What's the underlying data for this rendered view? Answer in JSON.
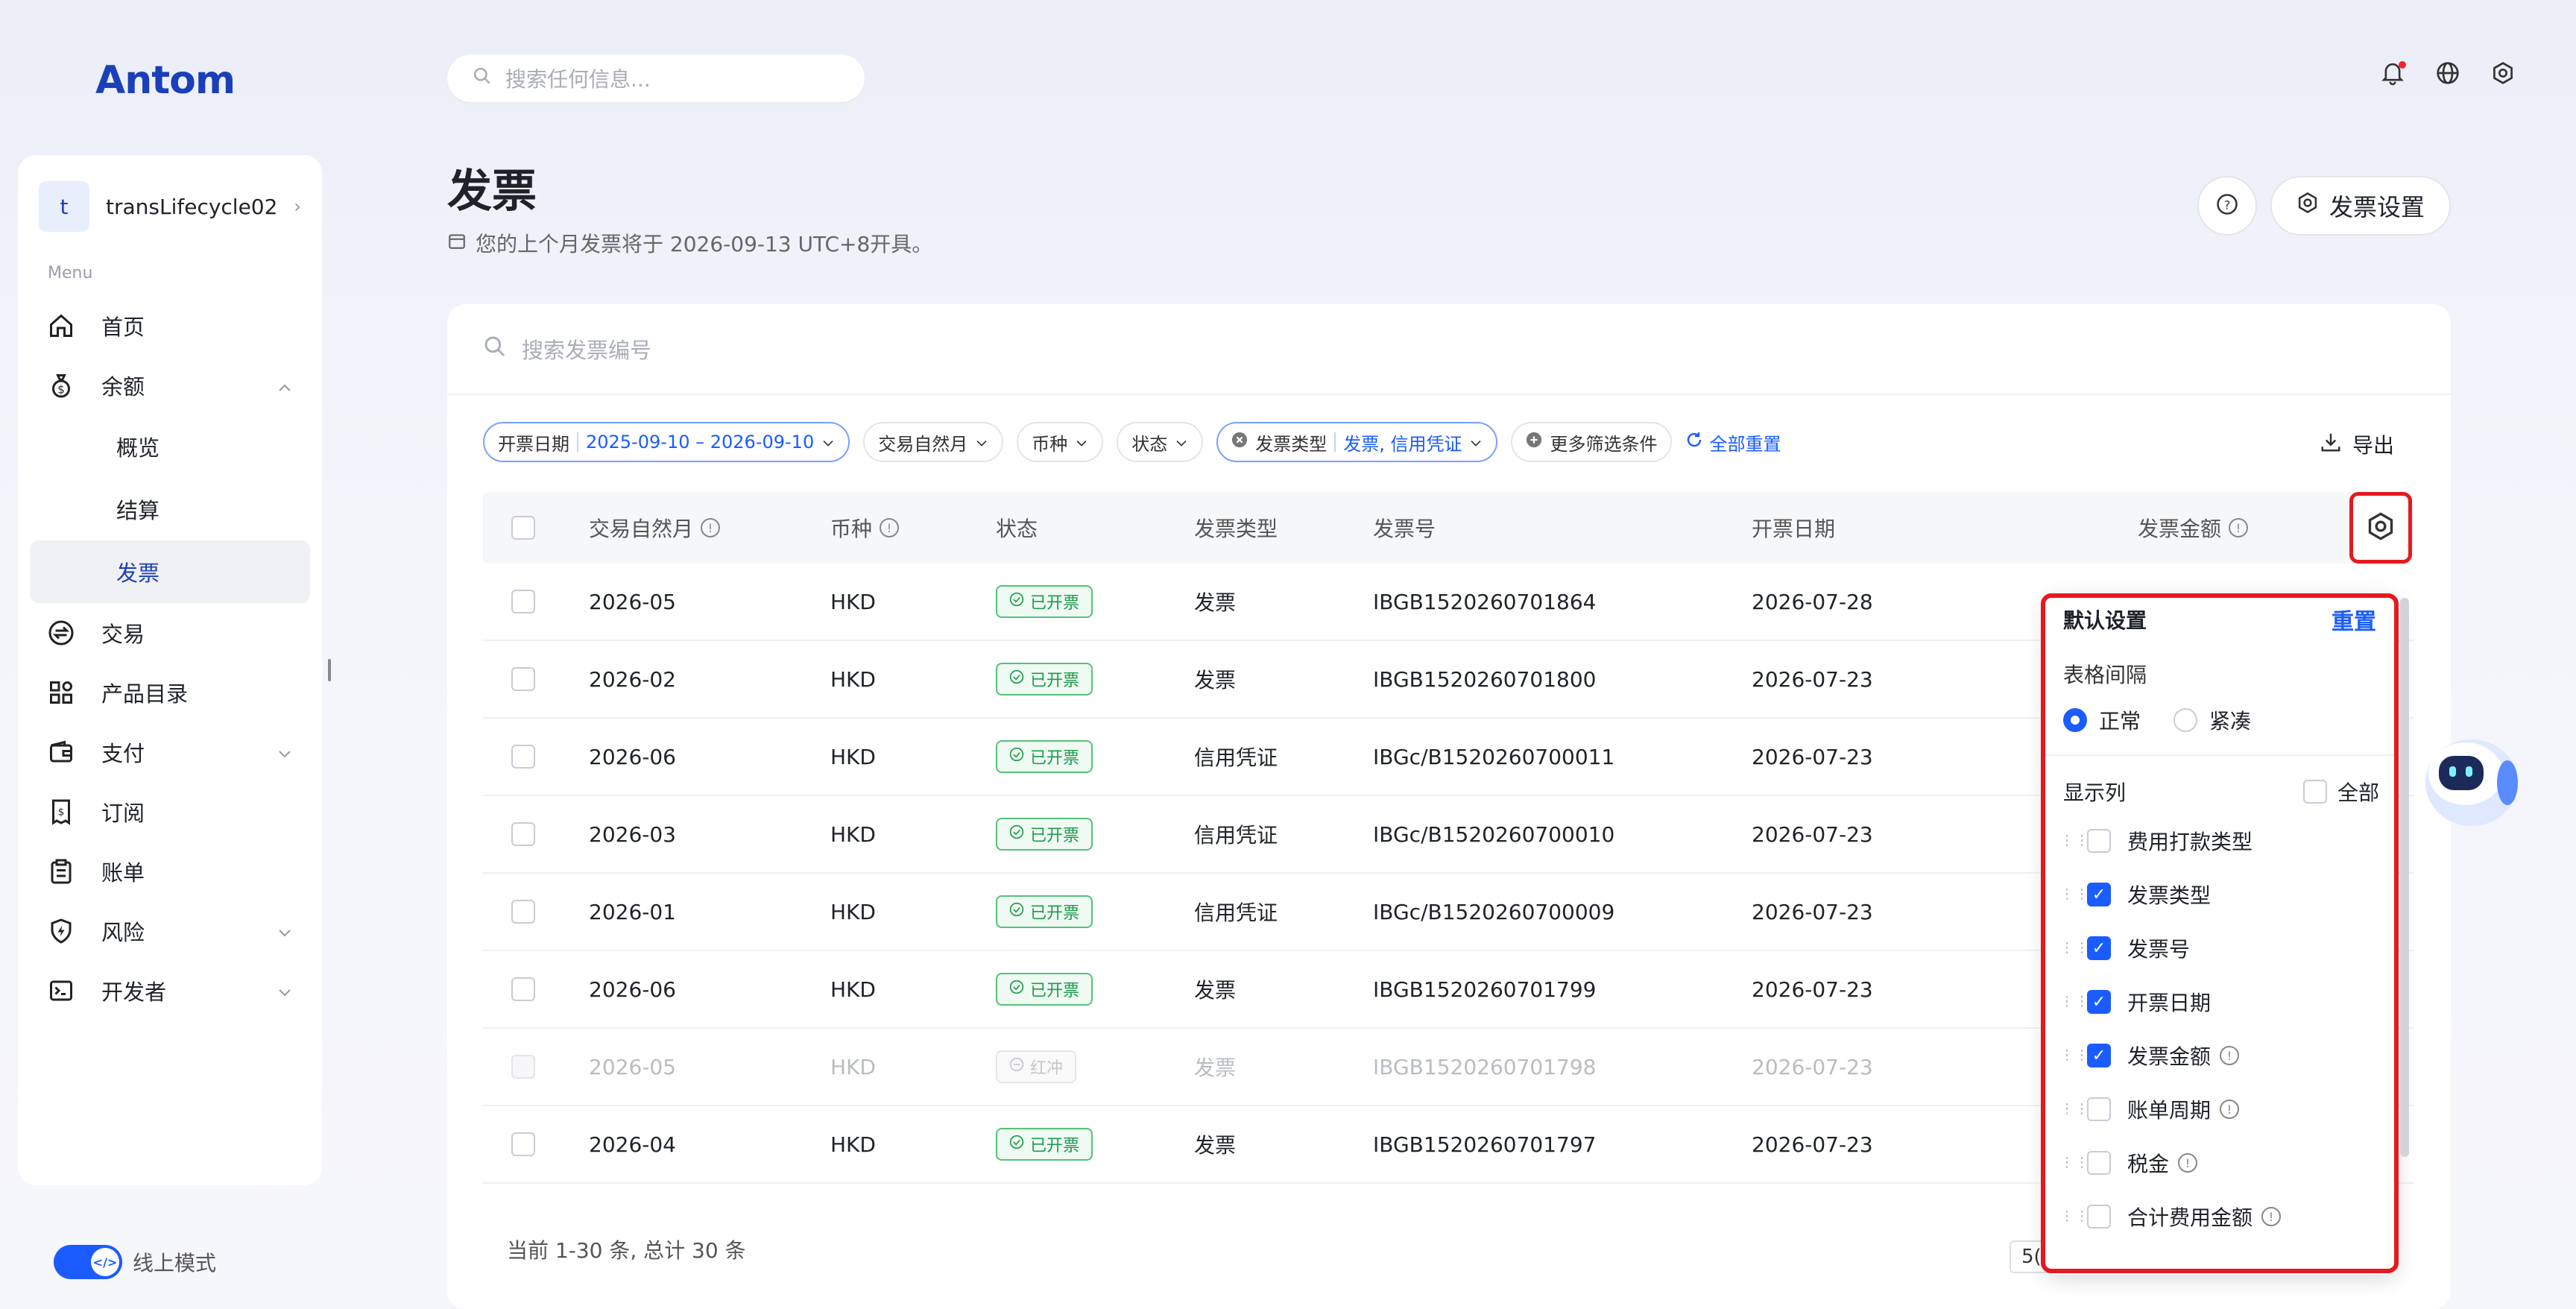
{
  "brand": {
    "logo": "Antom"
  },
  "topbar": {
    "search_placeholder": "搜索任何信息..."
  },
  "account": {
    "initial": "t",
    "name": "transLifecycle02"
  },
  "sidebar": {
    "menu_label": "Menu",
    "items": [
      {
        "label": "首页"
      },
      {
        "label": "余额"
      },
      {
        "label": "概览"
      },
      {
        "label": "结算"
      },
      {
        "label": "发票"
      },
      {
        "label": "交易"
      },
      {
        "label": "产品目录"
      },
      {
        "label": "支付"
      },
      {
        "label": "订阅"
      },
      {
        "label": "账单"
      },
      {
        "label": "风险"
      },
      {
        "label": "开发者"
      }
    ],
    "mode_label": "线上模式"
  },
  "header": {
    "title": "发票",
    "subtitle": "您的上个月发票将于 2026-09-13 UTC+8开具。",
    "settings_label": "发票设置"
  },
  "search": {
    "placeholder": "搜索发票编号"
  },
  "filters": {
    "date_label": "开票日期",
    "date_value": "2025-09-10 – 2026-09-10",
    "month_label": "交易自然月",
    "currency_label": "币种",
    "status_label": "状态",
    "type_label": "发票类型",
    "type_value": "发票, 信用凭证",
    "more_label": "更多筛选条件",
    "reset_label": "全部重置",
    "export_label": "导出"
  },
  "table": {
    "columns": [
      "交易自然月",
      "币种",
      "状态",
      "发票类型",
      "发票号",
      "开票日期",
      "发票金额"
    ],
    "rows": [
      {
        "month": "2026-05",
        "currency": "HKD",
        "status": "已开票",
        "type": "发票",
        "number": "IBGB1520260701864",
        "date": "2026-07-28"
      },
      {
        "month": "2026-02",
        "currency": "HKD",
        "status": "已开票",
        "type": "发票",
        "number": "IBGB1520260701800",
        "date": "2026-07-23"
      },
      {
        "month": "2026-06",
        "currency": "HKD",
        "status": "已开票",
        "type": "信用凭证",
        "number": "IBGc/B1520260700011",
        "date": "2026-07-23"
      },
      {
        "month": "2026-03",
        "currency": "HKD",
        "status": "已开票",
        "type": "信用凭证",
        "number": "IBGc/B1520260700010",
        "date": "2026-07-23"
      },
      {
        "month": "2026-01",
        "currency": "HKD",
        "status": "已开票",
        "type": "信用凭证",
        "number": "IBGc/B1520260700009",
        "date": "2026-07-23"
      },
      {
        "month": "2026-06",
        "currency": "HKD",
        "status": "已开票",
        "type": "发票",
        "number": "IBGB1520260701799",
        "date": "2026-07-23"
      },
      {
        "month": "2026-05",
        "currency": "HKD",
        "status": "红冲",
        "type": "发票",
        "number": "IBGB1520260701798",
        "date": "2026-07-23"
      },
      {
        "month": "2026-04",
        "currency": "HKD",
        "status": "已开票",
        "type": "发票",
        "number": "IBGB1520260701797",
        "date": "2026-07-23"
      }
    ],
    "footer": "当前 1-30 条, 总计 30 条",
    "page_size": "5("
  },
  "column_settings": {
    "title": "默认设置",
    "reset_label": "重置",
    "spacing_label": "表格间隔",
    "spacing_normal": "正常",
    "spacing_compact": "紧凑",
    "columns_label": "显示列",
    "all_label": "全部",
    "items": [
      {
        "label": "费用打款类型",
        "checked": false,
        "info": false
      },
      {
        "label": "发票类型",
        "checked": true,
        "info": false
      },
      {
        "label": "发票号",
        "checked": true,
        "info": false
      },
      {
        "label": "开票日期",
        "checked": true,
        "info": false
      },
      {
        "label": "发票金额",
        "checked": true,
        "info": true
      },
      {
        "label": "账单周期",
        "checked": false,
        "info": true
      },
      {
        "label": "税金",
        "checked": false,
        "info": true
      },
      {
        "label": "合计费用金额",
        "checked": false,
        "info": true
      }
    ]
  },
  "colors": {
    "accent": "#1a5cff",
    "brand": "#1a3fb8",
    "success": "#1f9a4c",
    "highlight": "#e5191e"
  }
}
